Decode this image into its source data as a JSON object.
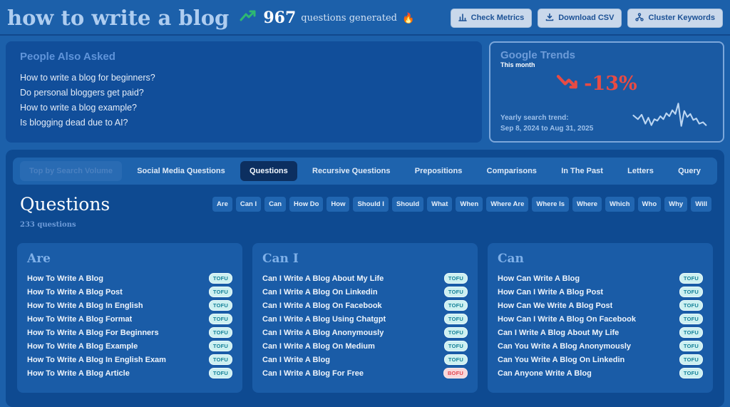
{
  "header": {
    "title": "how to write a blog",
    "count": "967",
    "count_suffix": "questions generated",
    "flame": "🔥",
    "buttons": [
      {
        "label": "Check Metrics",
        "icon": "bar-chart-icon"
      },
      {
        "label": "Download CSV",
        "icon": "download-icon"
      },
      {
        "label": "Cluster Keywords",
        "icon": "cluster-icon"
      }
    ]
  },
  "people_also_asked": {
    "title": "People Also Asked",
    "items": [
      "How to write a blog for beginners?",
      "Do personal bloggers get paid?",
      "How to write a blog example?",
      "Is blogging dead due to AI?"
    ]
  },
  "google_trends": {
    "title": "Google Trends",
    "period_label": "This month",
    "change": "-13%",
    "trend_label": "Yearly search trend:",
    "trend_range": "Sep 8, 2024 to Aug 31, 2025"
  },
  "tabs": [
    {
      "label": "Top by Search Volume",
      "state": "disabled"
    },
    {
      "label": "Social Media Questions",
      "state": ""
    },
    {
      "label": "Questions",
      "state": "active"
    },
    {
      "label": "Recursive Questions",
      "state": ""
    },
    {
      "label": "Prepositions",
      "state": ""
    },
    {
      "label": "Comparisons",
      "state": ""
    },
    {
      "label": "In The Past",
      "state": ""
    },
    {
      "label": "Letters",
      "state": ""
    },
    {
      "label": "Query",
      "state": ""
    }
  ],
  "questions_section": {
    "title": "Questions",
    "count_label": "233 questions",
    "filter_chips": [
      "Are",
      "Can I",
      "Can",
      "How Do",
      "How",
      "Should I",
      "Should",
      "What",
      "When",
      "Where Are",
      "Where Is",
      "Where",
      "Which",
      "Who",
      "Why",
      "Will"
    ],
    "columns": [
      {
        "title": "Are",
        "items": [
          {
            "text": "How To Write A Blog",
            "badge": "TOFU"
          },
          {
            "text": "How To Write A Blog Post",
            "badge": "TOFU"
          },
          {
            "text": "How To Write A Blog In English",
            "badge": "TOFU"
          },
          {
            "text": "How To Write A Blog Format",
            "badge": "TOFU"
          },
          {
            "text": "How To Write A Blog For Beginners",
            "badge": "TOFU"
          },
          {
            "text": "How To Write A Blog Example",
            "badge": "TOFU"
          },
          {
            "text": "How To Write A Blog In English Exam",
            "badge": "TOFU"
          },
          {
            "text": "How To Write A Blog Article",
            "badge": "TOFU"
          }
        ]
      },
      {
        "title": "Can I",
        "items": [
          {
            "text": "Can I Write A Blog About My Life",
            "badge": "TOFU"
          },
          {
            "text": "Can I Write A Blog On Linkedin",
            "badge": "TOFU"
          },
          {
            "text": "Can I Write A Blog On Facebook",
            "badge": "TOFU"
          },
          {
            "text": "Can I Write A Blog Using Chatgpt",
            "badge": "TOFU"
          },
          {
            "text": "Can I Write A Blog Anonymously",
            "badge": "TOFU"
          },
          {
            "text": "Can I Write A Blog On Medium",
            "badge": "TOFU"
          },
          {
            "text": "Can I Write A Blog",
            "badge": "TOFU"
          },
          {
            "text": "Can I Write A Blog For Free",
            "badge": "BOFU"
          }
        ]
      },
      {
        "title": "Can",
        "items": [
          {
            "text": "How Can Write A Blog",
            "badge": "TOFU"
          },
          {
            "text": "How Can I Write A Blog Post",
            "badge": "TOFU"
          },
          {
            "text": "How Can We Write A Blog Post",
            "badge": "TOFU"
          },
          {
            "text": "How Can I Write A Blog On Facebook",
            "badge": "TOFU"
          },
          {
            "text": "Can I Write A Blog About My Life",
            "badge": "TOFU"
          },
          {
            "text": "Can You Write A Blog Anonymously",
            "badge": "TOFU"
          },
          {
            "text": "Can You Write A Blog On Linkedin",
            "badge": "TOFU"
          },
          {
            "text": "Can Anyone Write A Blog",
            "badge": "TOFU"
          }
        ]
      }
    ]
  },
  "colors": {
    "page_bg": "#1c60aa",
    "panel_bg": "#114e9a",
    "accent_green": "#2eb872",
    "accent_red": "#e84b44",
    "tofu_bg": "#cdf0f1",
    "tofu_text": "#128097",
    "bofu_bg": "#f8d7da",
    "bofu_text": "#e04550"
  }
}
